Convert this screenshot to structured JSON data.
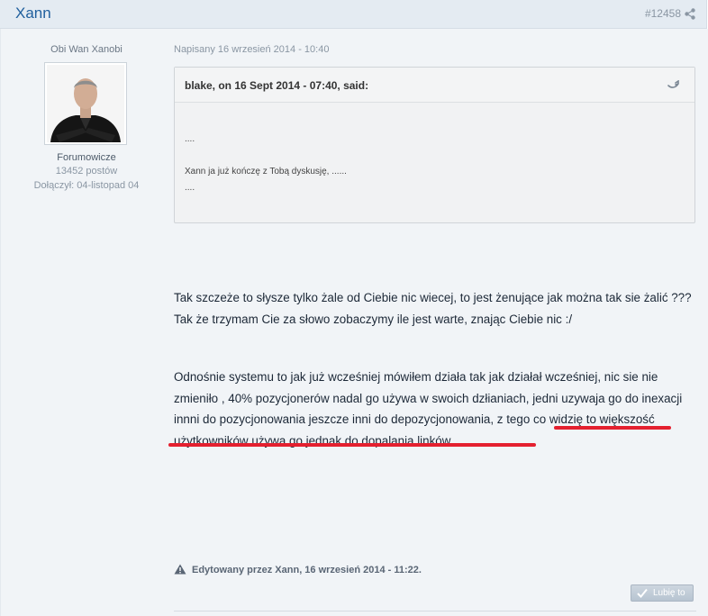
{
  "header": {
    "author_name": "Xann",
    "post_id": "#12458",
    "share_icon": "share-icon"
  },
  "author": {
    "title": "Obi Wan Xanobi",
    "group": "Forumowicze",
    "posts": "13452 postów",
    "joined": "Dołączył: 04-listopad 04"
  },
  "post": {
    "date": "Napisany 16 wrzesień 2014 - 10:40",
    "quote": {
      "citation": "blake, on 16 Sept 2014 - 07:40, said:",
      "lines": [
        "....",
        "Xann ja już kończę z Tobą dyskusję, ......",
        "...."
      ]
    },
    "paragraph1": "Tak szczeże to słysze tylko żale od Ciebie nic wiecej, to jest żenujące jak można tak sie żalić ???  Tak że  trzymam Cie za słowo zobaczymy ile jest warte, znając Ciebie nic :/",
    "paragraph2": "Odnośnie systemu to jak już wcześniej mówiłem działa tak jak działał wcześniej, nic sie nie zmieniło , 40% pozycjonerów nadal go używa w swoich dzłianiach, jedni uzywaja go do inexacji innni do pozycjonowania jeszcze inni do depozycjonowania, z tego co widzię to większość użytkowników używa go jednak do dopalania linków",
    "edit_note": "Edytowany przez Xann, 16 wrzesień 2014 - 11:22.",
    "like_label": "Lubię to"
  },
  "colors": {
    "accent": "#21609e",
    "highlight_underline": "#e4202f"
  }
}
